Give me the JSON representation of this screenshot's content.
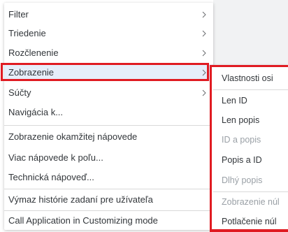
{
  "context_menu": {
    "items": [
      {
        "label": "Filter",
        "has_submenu": true
      },
      {
        "label": "Triedenie",
        "has_submenu": true
      },
      {
        "label": "Rozčlenenie",
        "has_submenu": true
      },
      {
        "label": "Zobrazenie",
        "has_submenu": true,
        "selected": true
      },
      {
        "label": "Súčty",
        "has_submenu": true
      },
      {
        "label": "Navigácia k...",
        "has_submenu": false
      },
      {
        "label": "Zobrazenie okamžitej nápovede",
        "has_submenu": false
      },
      {
        "label": "Viac nápovede k poľu...",
        "has_submenu": false
      },
      {
        "label": "Technická nápoveď...",
        "has_submenu": false
      },
      {
        "label": "Výmaz histórie zadaní pre užívateľa",
        "has_submenu": false
      },
      {
        "label": "Call Application in Customizing mode",
        "has_submenu": false
      }
    ]
  },
  "submenu": {
    "items": [
      {
        "label": "Vlastnosti osi",
        "enabled": true
      },
      {
        "label": "Len ID",
        "enabled": true
      },
      {
        "label": "Len popis",
        "enabled": true
      },
      {
        "label": "ID a popis",
        "enabled": false
      },
      {
        "label": "Popis a ID",
        "enabled": true
      },
      {
        "label": "Dlhý popis",
        "enabled": false
      },
      {
        "label": "Zobrazenie núl",
        "enabled": false
      },
      {
        "label": "Potlačenie núl",
        "enabled": true
      }
    ]
  },
  "colors": {
    "highlight_border": "#e01b22",
    "text": "#32363a",
    "disabled_text": "#9aa0a6",
    "separator": "#d9d9d9"
  }
}
